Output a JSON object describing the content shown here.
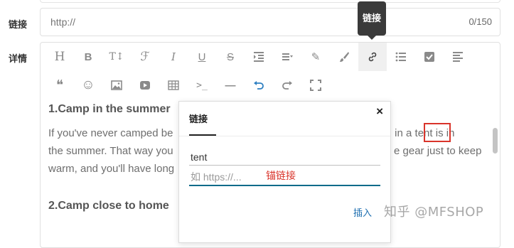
{
  "form": {
    "link_label": "链接",
    "detail_label": "详情",
    "link_placeholder": "http://",
    "link_count": "0/150"
  },
  "toolbar": {
    "tooltip": "链接",
    "row1": [
      {
        "icon": "heading-icon",
        "glyph": "H"
      },
      {
        "icon": "bold-icon",
        "glyph": "B"
      },
      {
        "icon": "font-size-icon",
        "glyph": "T↕"
      },
      {
        "icon": "font-family-icon",
        "glyph": "ℱ"
      },
      {
        "icon": "italic-icon",
        "glyph": "I"
      },
      {
        "icon": "underline-icon",
        "glyph": "U"
      },
      {
        "icon": "strikethrough-icon",
        "glyph": "S"
      },
      {
        "icon": "indent-icon",
        "glyph": ""
      },
      {
        "icon": "line-height-icon",
        "glyph": ""
      },
      {
        "icon": "font-color-icon",
        "glyph": "✎"
      },
      {
        "icon": "background-color-icon",
        "glyph": "🖌"
      },
      {
        "icon": "link-icon",
        "glyph": ""
      },
      {
        "icon": "list-icon",
        "glyph": ""
      },
      {
        "icon": "todo-icon",
        "glyph": "✔"
      },
      {
        "icon": "align-icon",
        "glyph": ""
      }
    ],
    "row2": [
      {
        "icon": "quote-icon",
        "glyph": "❝"
      },
      {
        "icon": "emoji-icon",
        "glyph": "☺"
      },
      {
        "icon": "image-icon",
        "glyph": ""
      },
      {
        "icon": "video-icon",
        "glyph": "▶"
      },
      {
        "icon": "table-icon",
        "glyph": ""
      },
      {
        "icon": "code-icon",
        "glyph": ">_"
      },
      {
        "icon": "divider-icon",
        "glyph": "—"
      },
      {
        "icon": "undo-icon",
        "glyph": "↶"
      },
      {
        "icon": "redo-icon",
        "glyph": "↷"
      },
      {
        "icon": "fullscreen-icon",
        "glyph": "⛶"
      }
    ]
  },
  "content": {
    "heading1": "1.Camp in the summer",
    "para_line1_a": "If you've never camped be",
    "para_line1_b": "ing in a ",
    "para_link_word": "tent",
    "para_line1_c": "is in",
    "para_line2_a": "the summer. That way you",
    "para_line2_b": "e gear just to keep",
    "para_line3_a": "warm, and you'll have long",
    "heading2": "2.Camp close to home"
  },
  "link_popup": {
    "tab": "链接",
    "close": "×",
    "text_value": "tent",
    "url_placeholder": "如 https://...",
    "url_annotation": "锚链接",
    "insert_label": "插入"
  },
  "watermark": "知乎 @MFSHOP"
}
